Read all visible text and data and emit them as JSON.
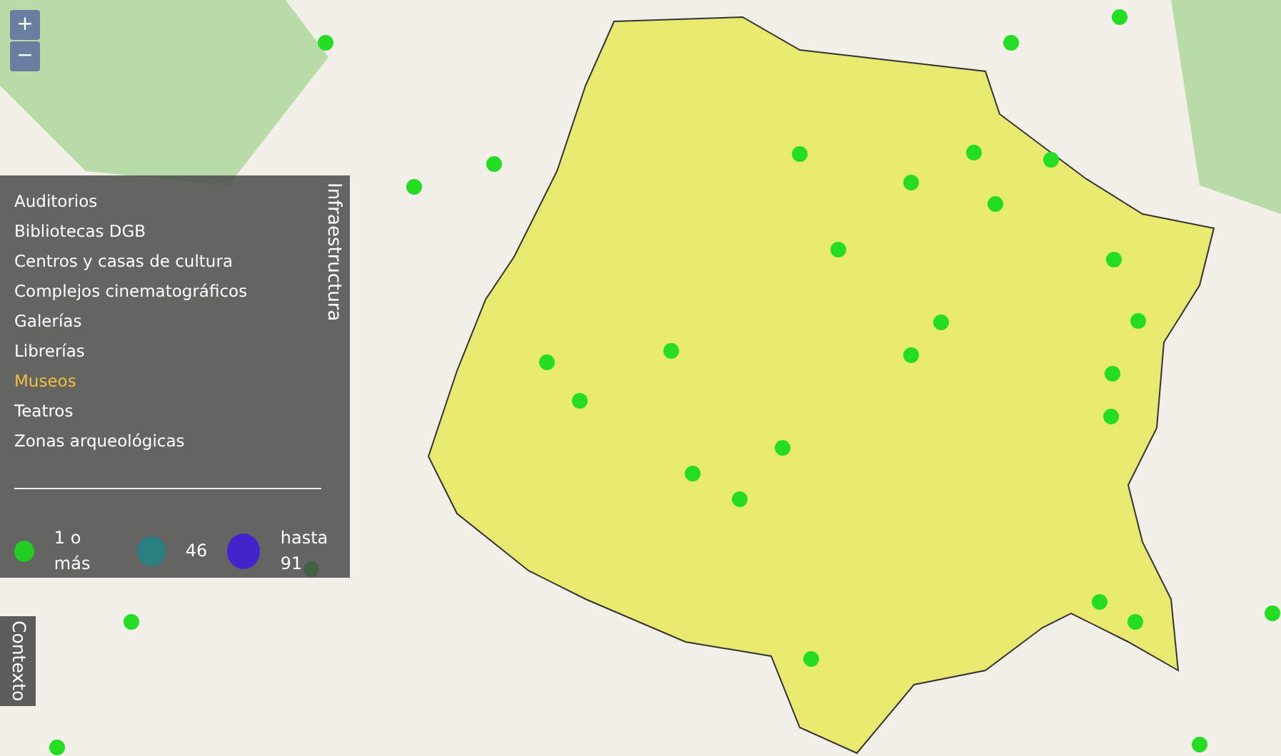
{
  "zoom_controls": [
    {
      "label": "+"
    },
    {
      "label": "−"
    }
  ],
  "infrastructure_panel": {
    "tab_label": "Infraestructura",
    "items": [
      {
        "label": "Auditorios",
        "selected": false
      },
      {
        "label": "Bibliotecas  DGB",
        "selected": false
      },
      {
        "label": "Centros y casas de cultura",
        "selected": false
      },
      {
        "label": "Complejos cinematográficos",
        "selected": false
      },
      {
        "label": "Galerías",
        "selected": false
      },
      {
        "label": "Librerías",
        "selected": false
      },
      {
        "label": "Museos",
        "selected": true
      },
      {
        "label": "Teatros",
        "selected": false
      },
      {
        "label": "Zonas arqueológicas",
        "selected": false
      }
    ],
    "legend": [
      {
        "label": "1 o más",
        "color": "#22cc22",
        "kind": "small"
      },
      {
        "label": "46",
        "color": "#2a8080",
        "kind": "medium"
      },
      {
        "label": "hasta 91",
        "color": "#4422cc",
        "kind": "large"
      }
    ]
  },
  "context_tab": {
    "label": "Contexto"
  }
}
